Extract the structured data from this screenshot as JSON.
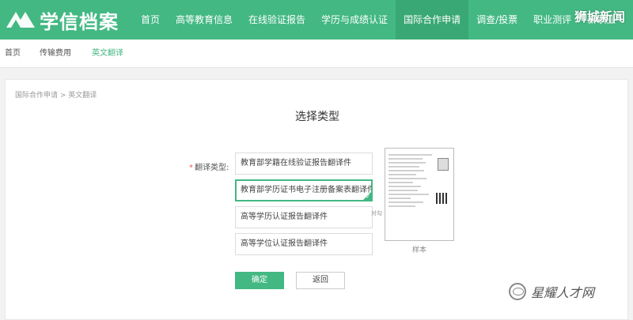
{
  "header": {
    "logo_text": "学信档案",
    "nav": [
      {
        "label": "首页",
        "active": false
      },
      {
        "label": "高等教育信息",
        "active": false
      },
      {
        "label": "在线验证报告",
        "active": false
      },
      {
        "label": "学历与成绩认证",
        "active": false
      },
      {
        "label": "国际合作申请",
        "active": true
      },
      {
        "label": "调查/投票",
        "active": false
      },
      {
        "label": "职业测评",
        "active": false
      },
      {
        "label": "新职业",
        "active": false
      }
    ],
    "watermark": "狮城新闻"
  },
  "subnav": {
    "items": [
      "首页",
      "传输费用",
      "英文翻译"
    ],
    "active_index": 2
  },
  "content": {
    "breadcrumb": "国际合作申请 > 英文翻译",
    "title": "选择类型",
    "field_required_mark": "*",
    "field_label": "翻译类型:",
    "options": [
      "教育部学籍在线验证报告翻译件",
      "教育部学历证书电子注册备案表翻译件",
      "高等学历认证报告翻译件",
      "高等学位认证报告翻译件"
    ],
    "selected_index": 1,
    "hint_text": "对勾",
    "check_glyph": "✓",
    "sample_label": "样本",
    "confirm_label": "确定",
    "back_label": "返回"
  },
  "bottom_watermark": "星耀人才网",
  "colors": {
    "brand": "#43b883",
    "brand_active": "#3aa874"
  }
}
